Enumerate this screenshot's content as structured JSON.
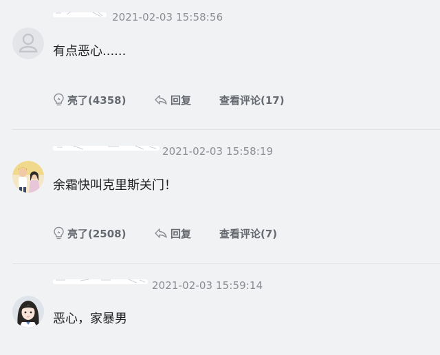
{
  "comments": [
    {
      "time": "2021-02-03 15:58:56",
      "text": "有点恶心......",
      "avatar": "default-user-icon",
      "like_label": "亮了(4358)",
      "reply_label": "回复",
      "view_label": "查看评论(17)"
    },
    {
      "time": "2021-02-03 15:58:19",
      "text": "余霜快叫克里斯关门！",
      "avatar": "couple-photo",
      "like_label": "亮了(2508)",
      "reply_label": "回复",
      "view_label": "查看评论(7)"
    },
    {
      "time": "2021-02-03 15:59:14",
      "text": "恶心，家暴男",
      "avatar": "girl-photo"
    }
  ],
  "icons": {
    "like": "lightbulb-icon",
    "reply": "reply-arrow-icon"
  },
  "colors": {
    "background": "#f1f2f4",
    "time": "#8a8d92",
    "action": "#666a70",
    "divider": "#dfe0e3"
  }
}
